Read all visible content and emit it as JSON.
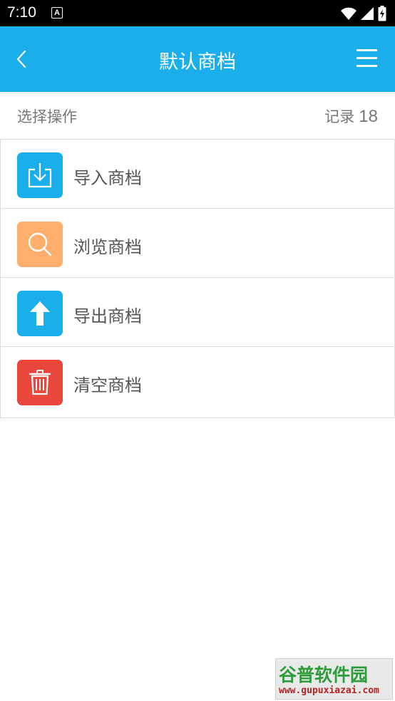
{
  "status_bar": {
    "time": "7:10",
    "notification_icon": "A"
  },
  "app_bar": {
    "title": "默认商档",
    "back_icon": "chevron-left-icon",
    "menu_icon": "hamburger-menu-icon",
    "background_color": "#1aaeeb"
  },
  "section": {
    "title": "选择操作",
    "count_label": "记录",
    "count_value": "18"
  },
  "menu_items": [
    {
      "label": "导入商档",
      "icon": "import-icon",
      "color": "#1aaeeb"
    },
    {
      "label": "浏览商档",
      "icon": "search-icon",
      "color": "#ffae6b"
    },
    {
      "label": "导出商档",
      "icon": "upload-arrow-icon",
      "color": "#1aaeeb"
    },
    {
      "label": "清空商档",
      "icon": "trash-icon",
      "color": "#e9463c"
    }
  ],
  "watermark": {
    "title": "谷普软件园",
    "url": "www.gupuxiazai.com"
  }
}
